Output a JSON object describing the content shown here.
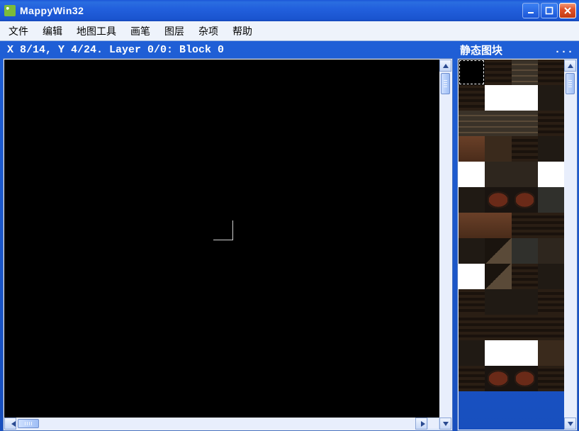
{
  "window": {
    "title": "MappyWin32"
  },
  "menu": {
    "items": [
      "文件",
      "编辑",
      "地图工具",
      "画笔",
      "图层",
      "杂项",
      "帮助"
    ]
  },
  "status": {
    "text": "X 8/14, Y 4/24. Layer 0/0: Block 0"
  },
  "tile_panel": {
    "title": "静态图块",
    "more": "...",
    "tiles": [
      {
        "style": "t-black",
        "selected": true
      },
      {
        "style": "t-brick"
      },
      {
        "style": "t-rails"
      },
      {
        "style": "t-brick"
      },
      {
        "style": "t-brick"
      },
      {
        "style": "t-white"
      },
      {
        "style": "t-white"
      },
      {
        "style": "t-dark"
      },
      {
        "style": "t-rails"
      },
      {
        "style": "t-rails"
      },
      {
        "style": "t-rails"
      },
      {
        "style": "t-brick"
      },
      {
        "style": "t-dirt"
      },
      {
        "style": "t-brown2"
      },
      {
        "style": "t-brick"
      },
      {
        "style": "t-dark"
      },
      {
        "style": "t-white"
      },
      {
        "style": "t-plate"
      },
      {
        "style": "t-plate"
      },
      {
        "style": "t-white"
      },
      {
        "style": "t-dark"
      },
      {
        "style": "t-barrel"
      },
      {
        "style": "t-barrel"
      },
      {
        "style": "t-gray"
      },
      {
        "style": "t-dirt"
      },
      {
        "style": "t-dirt"
      },
      {
        "style": "t-brick"
      },
      {
        "style": "t-brick"
      },
      {
        "style": "t-dark"
      },
      {
        "style": "t-mix"
      },
      {
        "style": "t-gray"
      },
      {
        "style": "t-plate"
      },
      {
        "style": "t-white"
      },
      {
        "style": "t-mix"
      },
      {
        "style": "t-brick"
      },
      {
        "style": "t-dark"
      },
      {
        "style": "t-brick"
      },
      {
        "style": "t-dark"
      },
      {
        "style": "t-dark"
      },
      {
        "style": "t-brick"
      },
      {
        "style": "t-brick"
      },
      {
        "style": "t-brick"
      },
      {
        "style": "t-brick"
      },
      {
        "style": "t-brick"
      },
      {
        "style": "t-dark"
      },
      {
        "style": "t-white"
      },
      {
        "style": "t-white"
      },
      {
        "style": "t-brown2"
      },
      {
        "style": "t-brick"
      },
      {
        "style": "t-barrel"
      },
      {
        "style": "t-barrel"
      },
      {
        "style": "t-brick"
      }
    ]
  }
}
